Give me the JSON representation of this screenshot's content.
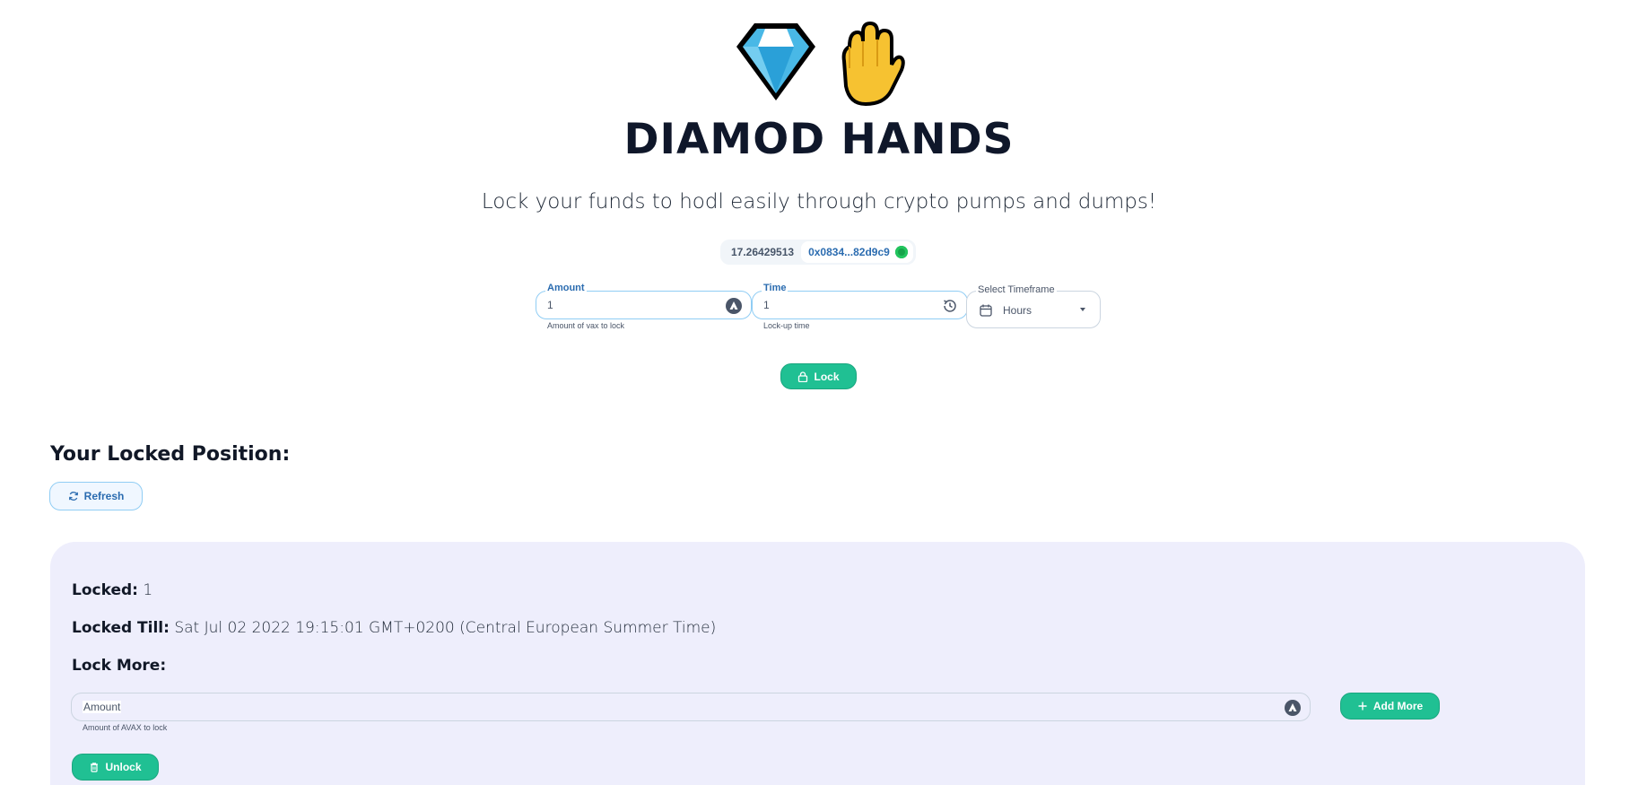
{
  "app": {
    "title": "DIAMOD HANDS",
    "subtitle": "Lock your funds to hodl easily through crypto pumps and dumps!",
    "logo_icons": [
      "gem-icon",
      "raised-hand-icon"
    ]
  },
  "wallet": {
    "balance": "17.26429513",
    "address": "0x0834...82d9c9"
  },
  "lock_form": {
    "amount_label": "Amount",
    "amount_value": "1",
    "amount_hint": "Amount of vax to lock",
    "time_label": "Time",
    "time_value": "1",
    "time_hint": "Lock-up time",
    "timeframe_label": "Select Timeframe",
    "timeframe_value": "Hours",
    "lock_button": "Lock"
  },
  "position": {
    "heading": "Your Locked Position:",
    "refresh_button": "Refresh",
    "locked_label": "Locked:",
    "locked_value": "1",
    "locked_till_label": "Locked Till:",
    "locked_till_value": "Sat Jul 02 2022 19:15:01 GMT+0200 (Central European Summer Time)",
    "lock_more_label": "Lock More:",
    "lock_more_placeholder": "Amount",
    "lock_more_hint": "Amount of AVAX to lock",
    "add_more_button": "Add More",
    "unlock_button": "Unlock"
  },
  "colors": {
    "accent_green": "#20c093",
    "link_blue": "#2b6cb0",
    "panel_bg": "#eeeefc"
  }
}
